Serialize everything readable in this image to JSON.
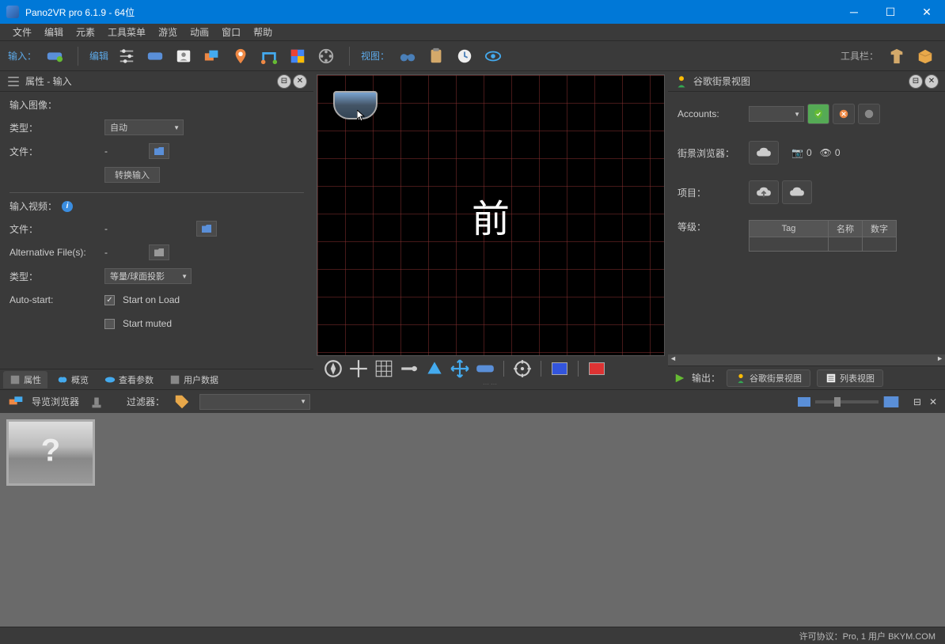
{
  "title": "Pano2VR pro 6.1.9 - 64位",
  "menu": [
    "文件",
    "编辑",
    "元素",
    "工具菜单",
    "游览",
    "动画",
    "窗口",
    "帮助"
  ],
  "toolbar": {
    "input_label": "输入：",
    "edit_label": "编辑",
    "view_label": "视图：",
    "tools_label": "工具栏："
  },
  "left_panel": {
    "title": "属性 - 输入",
    "input_image_section": "输入图像：",
    "type_label": "类型：",
    "type_value": "自动",
    "file_label": "文件：",
    "file_value": "-",
    "convert_btn": "转换输入",
    "input_video_section": "输入视频：",
    "video_file_label": "文件：",
    "video_file_value": "-",
    "alt_files_label": "Alternative File(s):",
    "alt_files_value": "-",
    "video_type_label": "类型：",
    "video_type_value": "等量/球面投影",
    "autostart_label": "Auto-start:",
    "autostart_check": "Start on Load",
    "muted_check": "Start muted",
    "tabs": [
      "属性",
      "概览",
      "查看参数",
      "用户数据"
    ]
  },
  "viewport": {
    "label": "前"
  },
  "right_panel": {
    "title": "谷歌街景视图",
    "accounts_label": "Accounts:",
    "browser_label": "街景浏览器：",
    "camera_count": "0",
    "eye_count": "0",
    "project_label": "项目：",
    "level_label": "等级：",
    "table_headers": [
      "Tag",
      "名称",
      "数字"
    ]
  },
  "output_bar": {
    "label": "输出：",
    "google_btn": "谷歌街景视图",
    "list_btn": "列表视图"
  },
  "browser": {
    "title": "导览浏览器",
    "filter_label": "过滤器："
  },
  "statusbar": "许可协议：Pro, 1 用户 BKYM.COM"
}
